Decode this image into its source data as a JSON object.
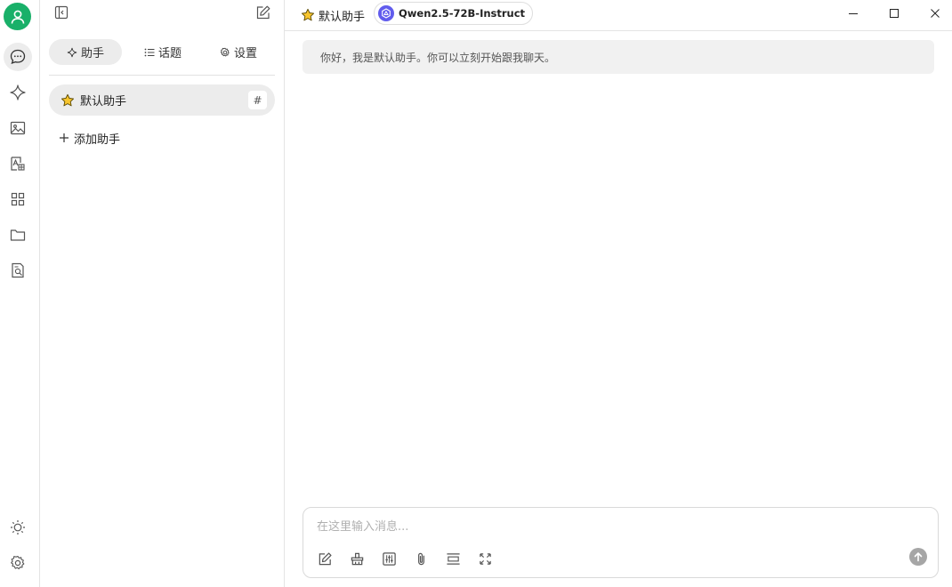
{
  "side": {
    "tabs": [
      {
        "label": "助手",
        "icon": "sparkle-icon"
      },
      {
        "label": "话题",
        "icon": "list-icon"
      },
      {
        "label": "设置",
        "icon": "gear-icon"
      }
    ],
    "assistant": {
      "label": "默认助手",
      "hash": "#"
    },
    "add_label": "添加助手"
  },
  "topbar": {
    "assistant_title": "默认助手",
    "model_name": "Qwen2.5-72B-Instruct"
  },
  "chat": {
    "greeting": "你好，我是默认助手。你可以立刻开始跟我聊天。"
  },
  "composer": {
    "placeholder": "在这里输入消息..."
  },
  "colors": {
    "brand_green": "#19b069",
    "model_logo": "#615ced",
    "active_bg": "#ececec"
  }
}
